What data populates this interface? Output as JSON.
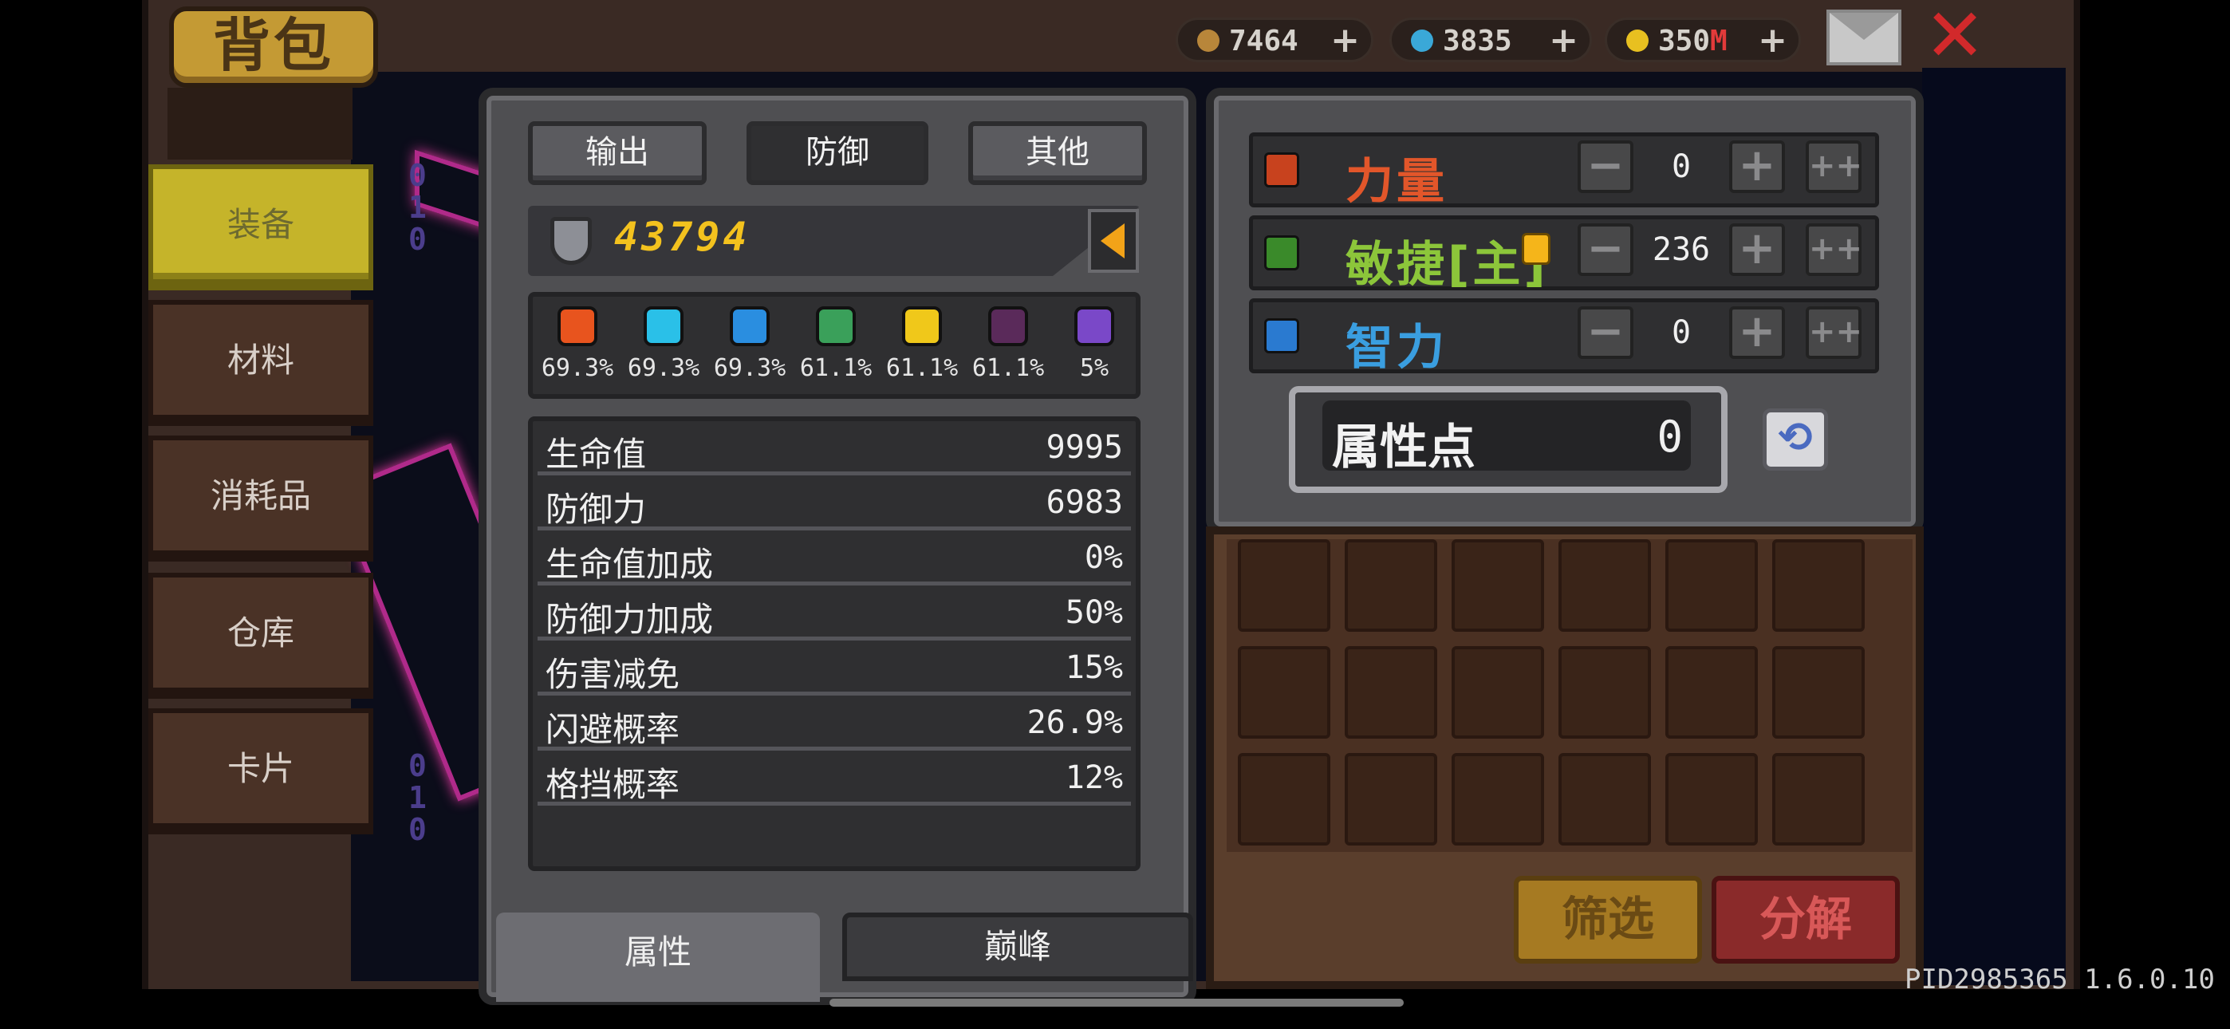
{
  "header": {
    "title": "背包",
    "currencies": [
      {
        "icon": "fist-icon",
        "value": "7464",
        "color": "#b8863a"
      },
      {
        "icon": "eye-gem-icon",
        "value": "3835",
        "color": "#3aa8d8"
      },
      {
        "icon": "coin-icon",
        "value": "350",
        "suffix": "M",
        "color": "#e8c020"
      }
    ],
    "plus": "+"
  },
  "sidebar": {
    "items": [
      {
        "label": "装备",
        "active": true
      },
      {
        "label": "材料"
      },
      {
        "label": "消耗品"
      },
      {
        "label": "仓库"
      },
      {
        "label": "卡片"
      }
    ]
  },
  "stats": {
    "tabs": [
      {
        "label": "输出"
      },
      {
        "label": "防御",
        "active": true
      },
      {
        "label": "其他"
      }
    ],
    "power": "43794",
    "resistances": [
      {
        "icon": "fire-icon",
        "value": "69.3%",
        "color": "#e8541e"
      },
      {
        "icon": "ice-icon",
        "value": "69.3%",
        "color": "#2ac0e8"
      },
      {
        "icon": "lightning-icon",
        "value": "69.3%",
        "color": "#2a8ee0"
      },
      {
        "icon": "poison-icon",
        "value": "61.1%",
        "color": "#3aa05a"
      },
      {
        "icon": "light-icon",
        "value": "61.1%",
        "color": "#f0c81a"
      },
      {
        "icon": "dark-icon",
        "value": "61.1%",
        "color": "#5a2a5a"
      },
      {
        "icon": "arcane-icon",
        "value": "5%",
        "color": "#7a48c8"
      }
    ],
    "rows": [
      {
        "key": "生命值",
        "value": "9995"
      },
      {
        "key": "防御力",
        "value": "6983"
      },
      {
        "key": "生命值加成",
        "value": "0%"
      },
      {
        "key": "防御力加成",
        "value": "50%"
      },
      {
        "key": "伤害减免",
        "value": "15%"
      },
      {
        "key": "闪避概率",
        "value": "26.9%"
      },
      {
        "key": "格挡概率",
        "value": "12%"
      }
    ],
    "bottom_tabs": [
      {
        "label": "属性",
        "active": true
      },
      {
        "label": "巅峰"
      }
    ]
  },
  "attributes": {
    "rows": [
      {
        "name": "力量",
        "value": "0",
        "color": "#e2562a",
        "icon": "strength-fist-icon",
        "icon_color": "#c8421e"
      },
      {
        "name": "敏捷[主]",
        "value": "236",
        "color": "#8cc63a",
        "icon": "agility-feather-icon",
        "icon_color": "#3a8a2a"
      },
      {
        "name": "智力",
        "value": "0",
        "color": "#3a9ee0",
        "icon": "intellect-book-icon",
        "icon_color": "#2a7ad0"
      }
    ],
    "minus": "−",
    "plus": "+",
    "plus_many": "++",
    "points_label": "属性点",
    "points_value": "0",
    "refresh": "⟲"
  },
  "inventory": {
    "filter_label": "筛选",
    "decompose_label": "分解"
  },
  "footer": {
    "version": "PID2985365 1.6.0.10"
  }
}
